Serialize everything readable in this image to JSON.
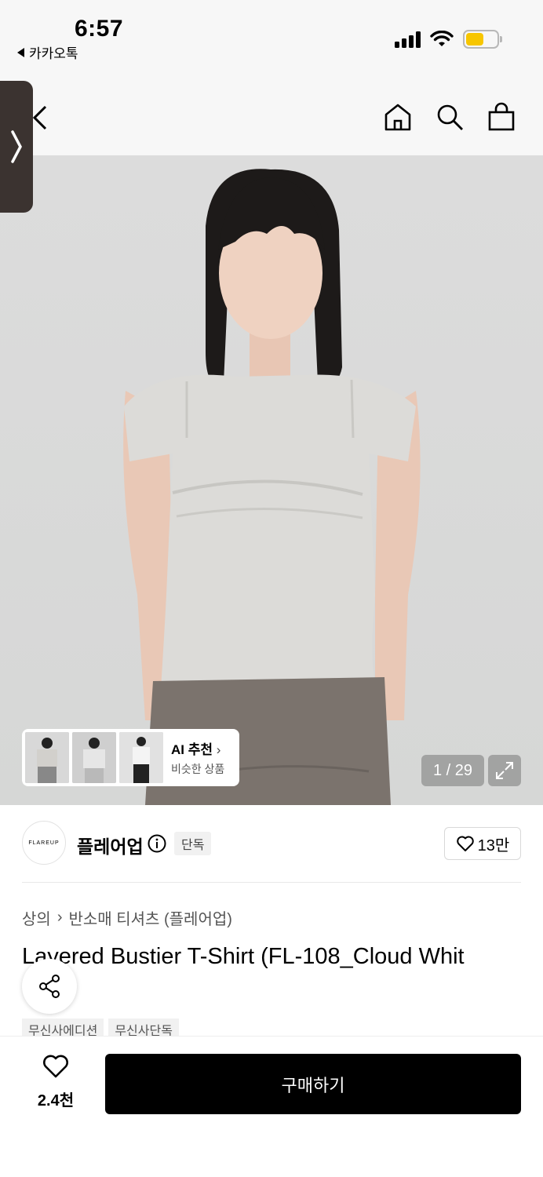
{
  "status_bar": {
    "time": "6:57",
    "back_app": "카카오톡"
  },
  "gallery": {
    "counter": "1 / 29",
    "ai_title": "AI 추천",
    "ai_sub": "비슷한 상품"
  },
  "brand": {
    "logo_text": "FLAREUP",
    "name": "플레어업",
    "badge": "단독",
    "likes": "13만"
  },
  "breadcrumb": {
    "category": "상의",
    "sub": "반소매 티셔츠 (플레어업)"
  },
  "product": {
    "title": "Layered Bustier T-Shirt (FL-108_Cloud Whit"
  },
  "tags": [
    "무신사에디션",
    "무신사단독"
  ],
  "bottom_bar": {
    "like_count": "2.4천",
    "buy_label": "구매하기"
  },
  "colors": {
    "battery": "#f7c600",
    "buy_button": "#000000"
  }
}
